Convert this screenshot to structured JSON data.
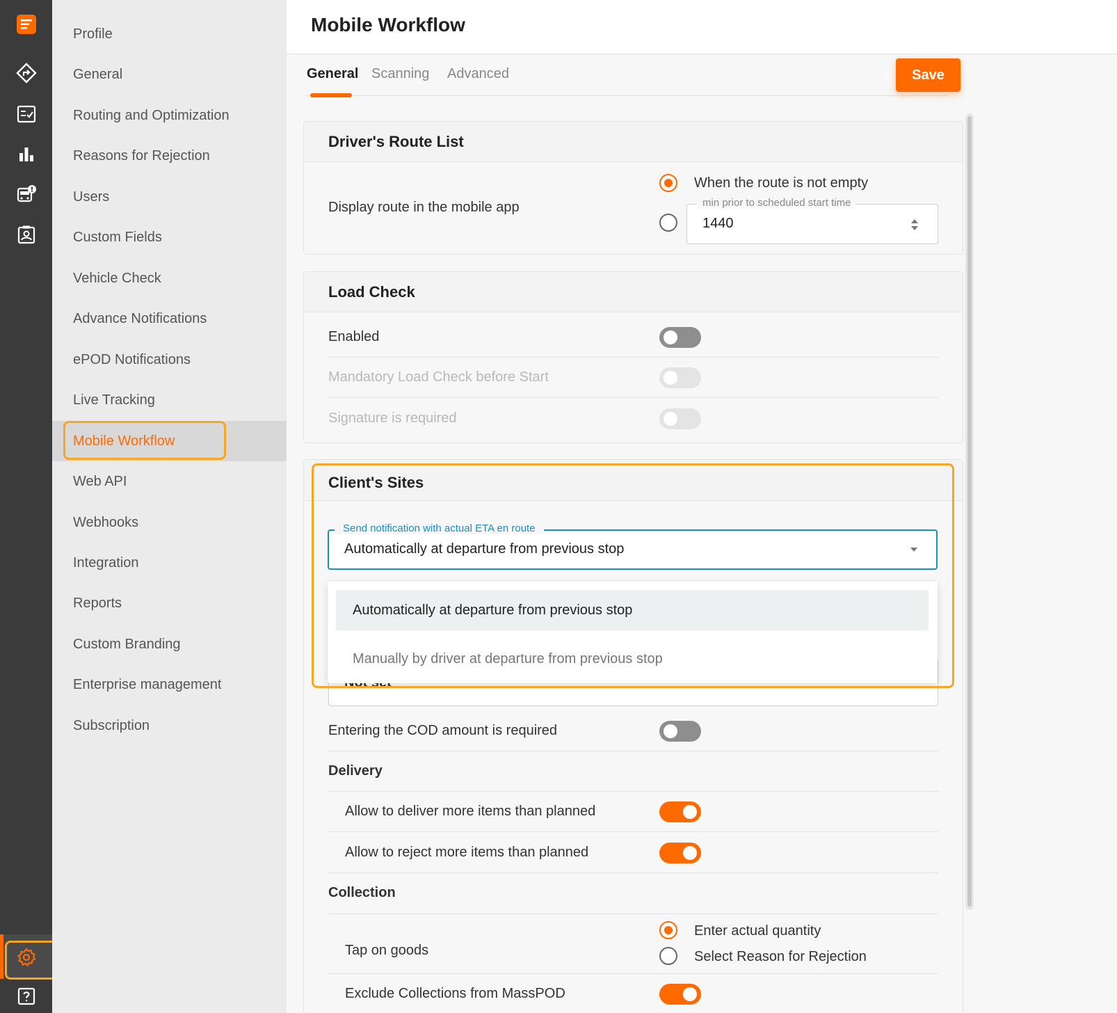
{
  "rail": {
    "icons": [
      "app-logo-icon",
      "route-icon",
      "task-list-icon",
      "analytics-icon",
      "vehicle-alert-icon",
      "driver-badge-icon",
      "gear-icon",
      "help-icon"
    ],
    "accent": "#ff6a00"
  },
  "nav": {
    "items": [
      "Profile",
      "General",
      "Routing and Optimization",
      "Reasons for Rejection",
      "Users",
      "Custom Fields",
      "Vehicle Check",
      "Advance Notifications",
      "ePOD Notifications",
      "Live Tracking",
      "Mobile Workflow",
      "Web API",
      "Webhooks",
      "Integration",
      "Reports",
      "Custom Branding",
      "Enterprise management",
      "Subscription"
    ],
    "active": "Mobile Workflow"
  },
  "header": {
    "title": "Mobile Workflow"
  },
  "tabs": [
    "General",
    "Scanning",
    "Advanced"
  ],
  "toolbar": {
    "save_label": "Save"
  },
  "route_list": {
    "title": "Driver's Route List",
    "label": "Display route in the mobile app",
    "option1": "When the route is not empty",
    "field_label": "min prior to scheduled start time",
    "field_value": "1440"
  },
  "load_check": {
    "title": "Load Check",
    "enabled_label": "Enabled",
    "mandatory_label": "Mandatory Load Check before Start",
    "signature_label": "Signature is required"
  },
  "client_sites": {
    "title": "Client's Sites",
    "eta_label": "Send notification with actual ETA en route",
    "eta_value": "Automatically at departure from previous stop",
    "options": [
      "Automatically at departure from previous stop",
      "Manually by driver at departure from previous stop"
    ],
    "obscured_value": "Not set"
  },
  "cod": {
    "label": "Entering the COD amount is required"
  },
  "delivery": {
    "title": "Delivery",
    "more_items": "Allow to deliver more items than planned",
    "reject_items": "Allow to reject more items than planned"
  },
  "collection": {
    "title": "Collection",
    "tap_label": "Tap on goods",
    "tap_option1": "Enter actual quantity",
    "tap_option2": "Select Reason for Rejection",
    "exclude_label": "Exclude Collections from MassPOD"
  }
}
